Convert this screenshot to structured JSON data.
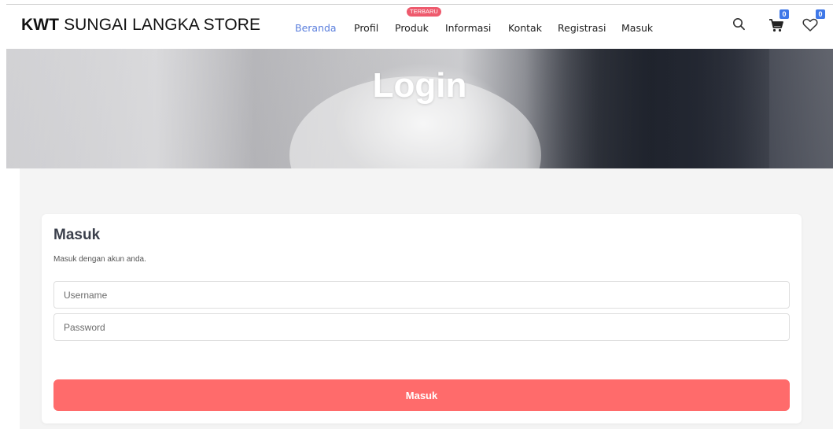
{
  "header": {
    "brand_bold": "KWT",
    "brand_rest": "SUNGAI LANGKA STORE",
    "nav": [
      {
        "label": "Beranda",
        "active": true
      },
      {
        "label": "Profil"
      },
      {
        "label": "Produk",
        "badge": "TERBARU"
      },
      {
        "label": "Informasi"
      },
      {
        "label": "Kontak"
      },
      {
        "label": "Registrasi"
      },
      {
        "label": "Masuk"
      }
    ],
    "icons": {
      "search": "search-icon",
      "cart": "cart-icon",
      "wishlist": "heart-icon"
    },
    "cart_count": "0",
    "wishlist_count": "0",
    "colors": {
      "active_nav": "#5b7fdd",
      "badge": "#ee5a6d",
      "count_badge": "#3f78e8"
    }
  },
  "hero": {
    "title": "Login"
  },
  "login": {
    "title": "Masuk",
    "subtitle": "Masuk dengan akun anda.",
    "username_placeholder": "Username",
    "password_placeholder": "Password",
    "submit_label": "Masuk",
    "colors": {
      "submit": "#ff6b6b"
    }
  }
}
